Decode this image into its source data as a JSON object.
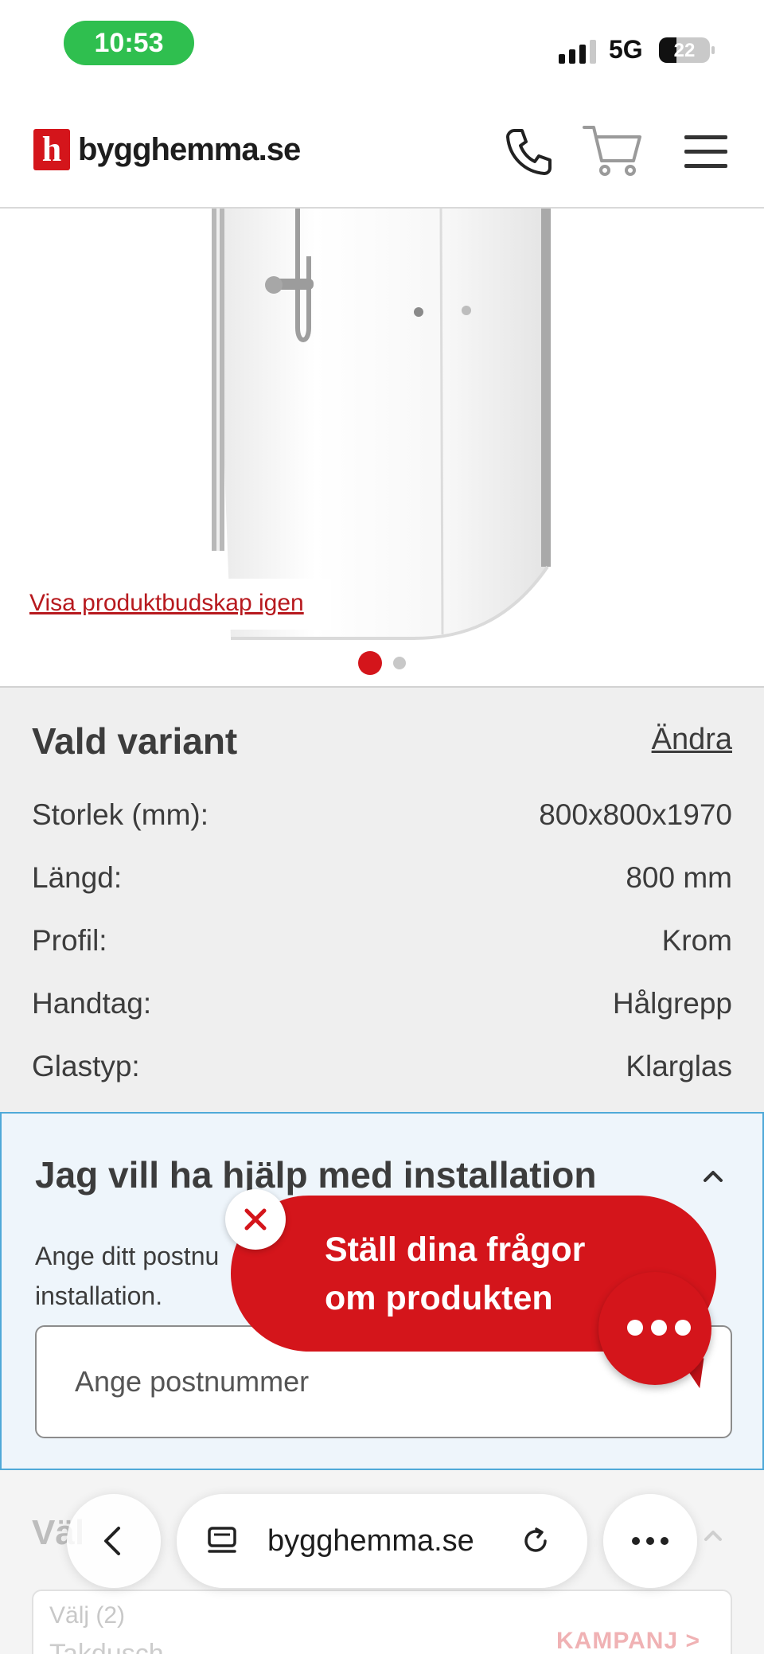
{
  "status_bar": {
    "time": "10:53",
    "network": "5G",
    "battery": "22"
  },
  "header": {
    "logo_letter": "h",
    "logo_text": "bygghemma.se"
  },
  "gallery": {
    "show_messages_link": "Visa produktbudskap igen",
    "slide_count": 2,
    "active_slide": 1
  },
  "variant": {
    "title": "Vald variant",
    "change_label": "Ändra",
    "specs": [
      {
        "label": "Storlek (mm):",
        "value": "800x800x1970"
      },
      {
        "label": "Längd:",
        "value": "800 mm"
      },
      {
        "label": "Profil:",
        "value": "Krom"
      },
      {
        "label": "Handtag:",
        "value": "Hålgrepp"
      },
      {
        "label": "Glastyp:",
        "value": "Klarglas"
      }
    ]
  },
  "installation": {
    "title": "Jag vill ha hjälp med installation",
    "description": "Ange ditt postnu installation.",
    "postcode_placeholder": "Ange postnummer"
  },
  "chat": {
    "cta_text": "Ställ dina frågor om produkten"
  },
  "lower_section": {
    "title": "Väl",
    "select_label": "Välj (2)",
    "select_value": "Takdusch",
    "badge": "KAMPANJ >"
  },
  "browser": {
    "url": "bygghemma.se"
  },
  "colors": {
    "brand_red": "#d4151b",
    "install_border": "#4fa9d8",
    "install_bg": "#eef5fb",
    "variant_bg": "#efefef"
  }
}
